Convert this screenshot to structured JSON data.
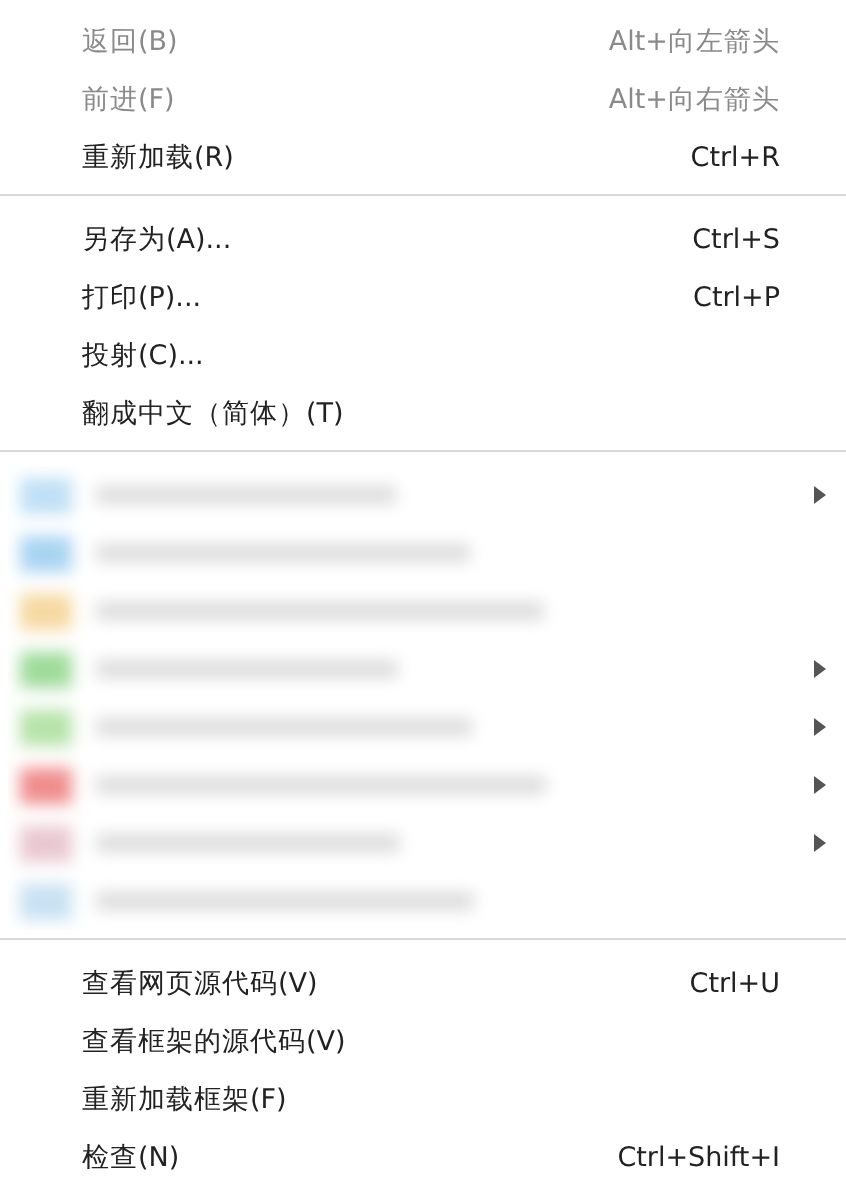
{
  "menu": [
    {
      "kind": "item",
      "label": "返回(B)",
      "shortcut": "Alt+向左箭头",
      "disabled": true
    },
    {
      "kind": "item",
      "label": "前进(F)",
      "shortcut": "Alt+向右箭头",
      "disabled": true
    },
    {
      "kind": "item",
      "label": "重新加载(R)",
      "shortcut": "Ctrl+R",
      "disabled": false
    },
    {
      "kind": "separator"
    },
    {
      "kind": "item",
      "label": "另存为(A)...",
      "shortcut": "Ctrl+S",
      "disabled": false
    },
    {
      "kind": "item",
      "label": "打印(P)...",
      "shortcut": "Ctrl+P",
      "disabled": false
    },
    {
      "kind": "item",
      "label": "投射(C)...",
      "disabled": false
    },
    {
      "kind": "item",
      "label": "翻成中文（简体）(T)",
      "disabled": false
    },
    {
      "kind": "separator"
    },
    {
      "kind": "blurred",
      "rows": [
        {
          "submenu": true
        },
        {
          "submenu": false
        },
        {
          "submenu": false
        },
        {
          "submenu": true
        },
        {
          "submenu": true
        },
        {
          "submenu": true
        },
        {
          "submenu": true
        },
        {
          "submenu": false
        }
      ]
    },
    {
      "kind": "separator"
    },
    {
      "kind": "item",
      "label": "查看网页源代码(V)",
      "shortcut": "Ctrl+U",
      "disabled": false
    },
    {
      "kind": "item",
      "label": "查看框架的源代码(V)",
      "disabled": false
    },
    {
      "kind": "item",
      "label": "重新加载框架(F)",
      "disabled": false
    },
    {
      "kind": "item",
      "label": "检查(N)",
      "shortcut": "Ctrl+Shift+I",
      "disabled": false
    }
  ]
}
